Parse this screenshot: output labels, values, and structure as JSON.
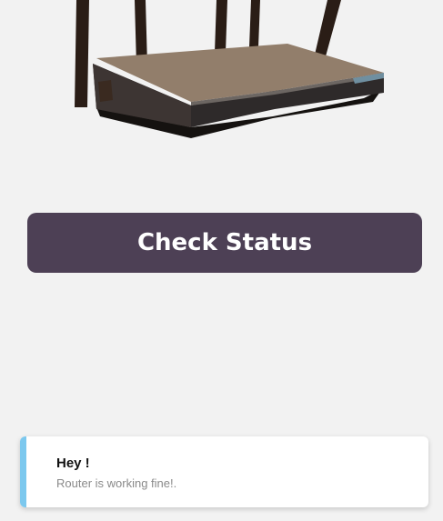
{
  "router_image": {
    "icon": "router-icon"
  },
  "actions": {
    "check_status_label": "Check Status"
  },
  "toast": {
    "title": "Hey !",
    "message": "Router is working fine!."
  },
  "colors": {
    "background": "#f2f2f2",
    "button": "#4d4055",
    "toast_accent": "#7cc8ee"
  }
}
